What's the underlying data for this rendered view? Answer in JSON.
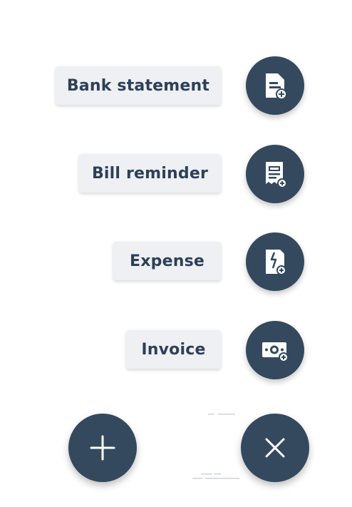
{
  "menu": {
    "items": [
      {
        "label": "Bank statement",
        "icon": "bank-statement-add-icon"
      },
      {
        "label": "Bill reminder",
        "icon": "bill-reminder-add-icon"
      },
      {
        "label": "Expense",
        "icon": "expense-add-icon"
      },
      {
        "label": "Invoice",
        "icon": "invoice-add-icon"
      }
    ]
  },
  "fabs": {
    "add_icon": "plus-icon",
    "close_icon": "close-icon"
  },
  "colors": {
    "fab": "#34495e",
    "label_bg": "#eef0f3",
    "label_text": "#2d4058"
  }
}
